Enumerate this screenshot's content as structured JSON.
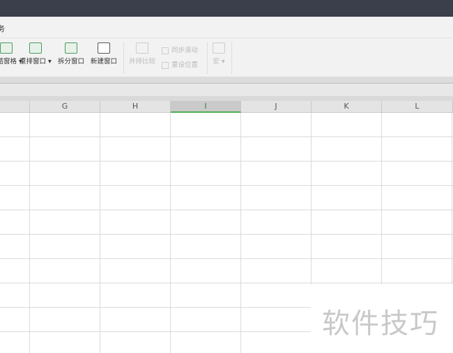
{
  "tab_partial": "务",
  "ribbon": {
    "freeze_panes": "冻结窗格",
    "rearrange": "重排窗口",
    "split": "拆分窗口",
    "new_window": "新建窗口",
    "compare": "并排比较",
    "sync_scroll": "同步滚动",
    "reset_position": "重设位置",
    "macro": "宏"
  },
  "columns": [
    "G",
    "H",
    "I",
    "J",
    "K",
    "L"
  ],
  "selected_column": "I",
  "watermark": "软件技巧"
}
